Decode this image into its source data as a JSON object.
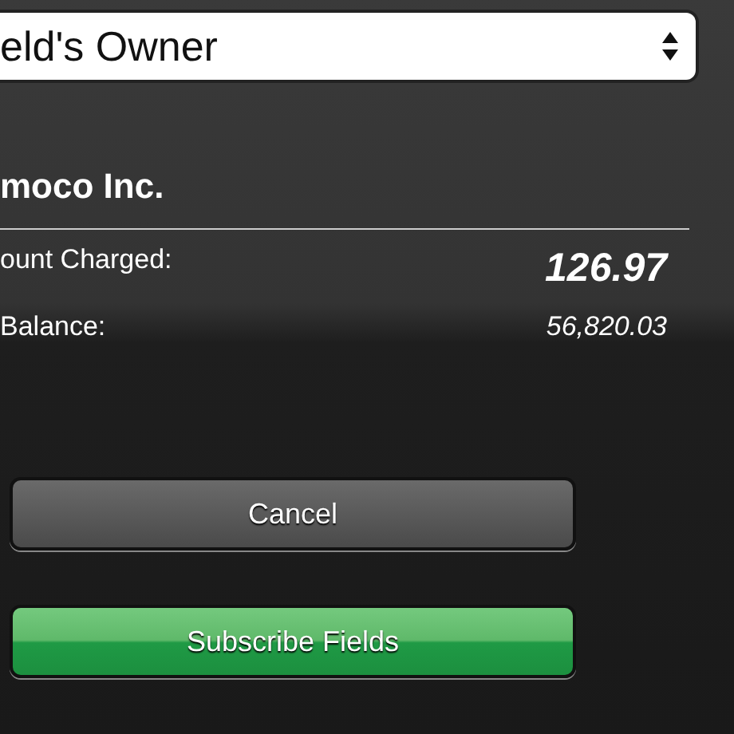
{
  "owner_select": {
    "value": "eld's Owner"
  },
  "company": "moco Inc.",
  "rows": [
    {
      "label": "ount Charged:",
      "value": "126.97",
      "kind": "total"
    },
    {
      "label": "Balance:",
      "value": "56,820.03",
      "kind": "balance"
    }
  ],
  "buttons": [
    {
      "label": "Cancel",
      "kind": "secondary"
    },
    {
      "label": "Subscribe Fields",
      "kind": "primary"
    }
  ]
}
